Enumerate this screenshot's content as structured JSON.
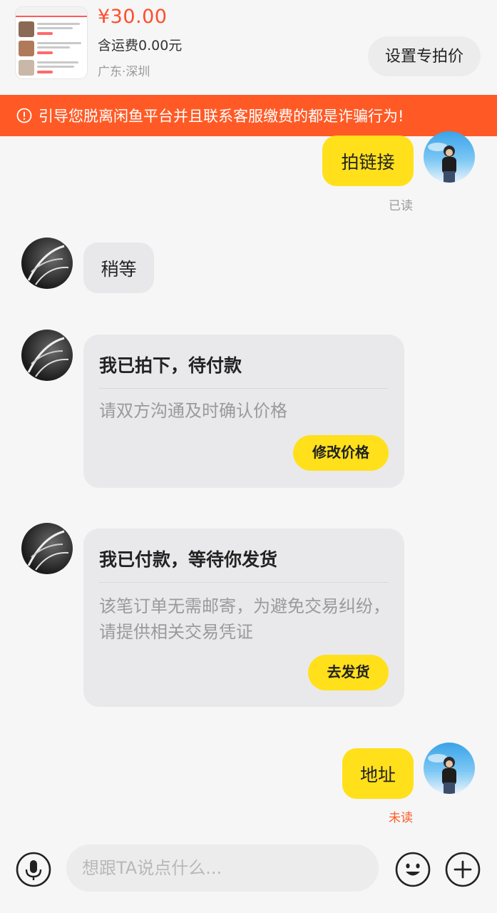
{
  "product": {
    "price": "¥30.00",
    "shipping": "含运费0.00元",
    "location": "广东·深圳",
    "special_price_label": "设置专拍价"
  },
  "warning": {
    "text": "引导您脱离闲鱼平台并且联系客服缴费的都是诈骗行为!"
  },
  "messages": [
    {
      "sender": "self",
      "text": "拍链接",
      "status": "已读",
      "status_color": "#9a9a9a"
    },
    {
      "sender": "peer",
      "text": "稍等"
    },
    {
      "sender": "peer",
      "card_title": "我已拍下，待付款",
      "card_desc": "请双方沟通及时确认价格",
      "card_button": "修改价格"
    },
    {
      "sender": "peer",
      "card_title": "我已付款，等待你发货",
      "card_desc": "该笔订单无需邮寄，为避免交易纠纷，请提供相关交易凭证",
      "card_button": "去发货"
    },
    {
      "sender": "self",
      "text": "地址",
      "status": "未读",
      "status_color": "#ff5a26"
    }
  ],
  "input": {
    "placeholder": "想跟TA说点什么..."
  },
  "colors": {
    "accent_yellow": "#ffe01b",
    "warning_orange": "#ff5a26",
    "price_red": "#ff4d2d"
  },
  "icons": {
    "voice": "microphone-icon",
    "emoji": "emoji-icon",
    "plus": "plus-icon",
    "warning": "info-circle-icon"
  }
}
